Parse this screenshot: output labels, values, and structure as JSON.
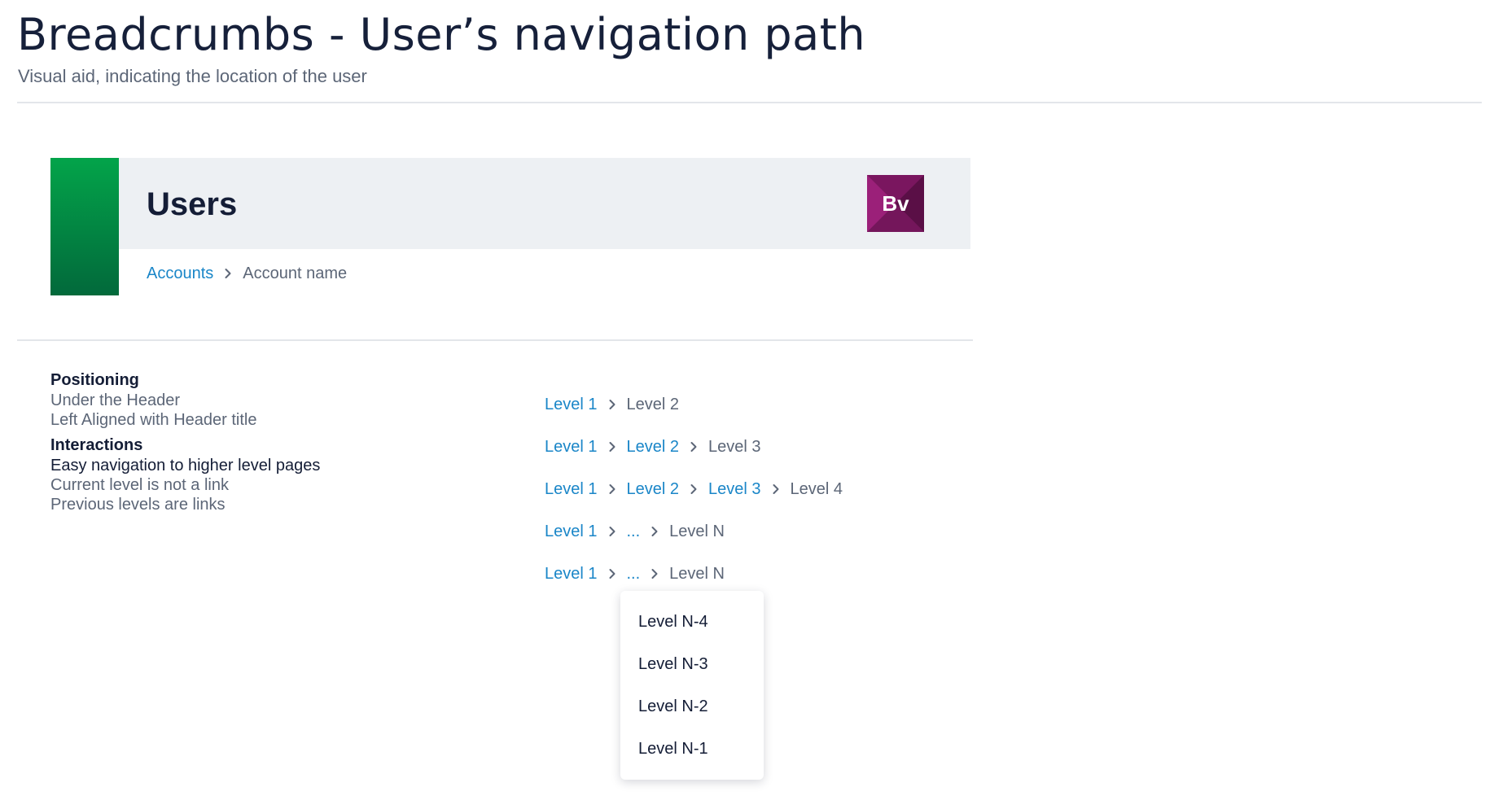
{
  "page": {
    "title": "Breadcrumbs - User’s navigation path",
    "subtitle": "Visual aid, indicating the location of the user"
  },
  "example_header": {
    "title": "Users",
    "logo_text": "Bv",
    "breadcrumb": {
      "link": "Accounts",
      "current": "Account name"
    }
  },
  "guidelines": {
    "positioning": {
      "heading": "Positioning",
      "lines": [
        "Under the Header",
        "Left Aligned with Header title"
      ]
    },
    "interactions": {
      "heading": "Interactions",
      "lines": [
        "Easy navigation to higher level pages",
        "Current level is not a link",
        "Previous levels are links"
      ]
    }
  },
  "examples": [
    {
      "links": [
        "Level 1"
      ],
      "current": "Level 2"
    },
    {
      "links": [
        "Level 1",
        "Level 2"
      ],
      "current": "Level 3"
    },
    {
      "links": [
        "Level 1",
        "Level 2",
        "Level 3"
      ],
      "current": "Level 4"
    },
    {
      "links": [
        "Level 1",
        "..."
      ],
      "current": "Level N"
    },
    {
      "links": [
        "Level 1",
        "..."
      ],
      "current": "Level N"
    }
  ],
  "dropdown": {
    "items": [
      "Level N-4",
      "Level N-3",
      "Level N-2",
      "Level N-1"
    ]
  },
  "icons": {
    "separator": "chevron-right-icon"
  },
  "colors": {
    "link": "#1a86c8",
    "current": "#5c6677",
    "heading": "#141d36",
    "brand_green_top": "#03a44a",
    "brand_green_bottom": "#02693b",
    "logo_purple": "#8a1a6c",
    "header_bg": "#edf0f3"
  }
}
